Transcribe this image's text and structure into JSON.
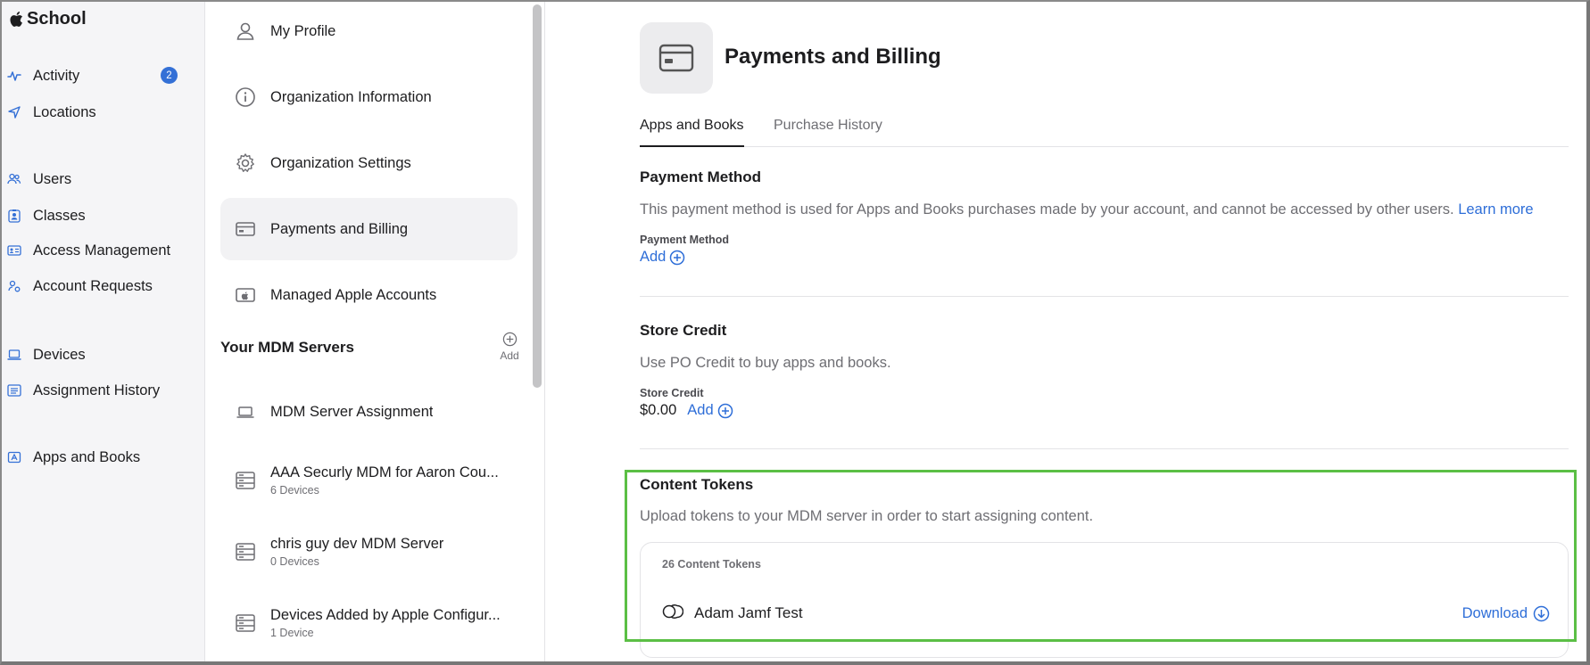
{
  "app": {
    "title": "School"
  },
  "sidebar": {
    "items": [
      {
        "label": "Activity",
        "icon": "activity-icon",
        "badge": "2"
      },
      {
        "label": "Locations",
        "icon": "location-arrow-icon"
      },
      {
        "label": "Users",
        "icon": "users-icon"
      },
      {
        "label": "Classes",
        "icon": "classes-icon"
      },
      {
        "label": "Access Management",
        "icon": "id-card-icon"
      },
      {
        "label": "Account Requests",
        "icon": "account-requests-icon"
      },
      {
        "label": "Devices",
        "icon": "laptop-icon"
      },
      {
        "label": "Assignment History",
        "icon": "list-icon"
      },
      {
        "label": "Apps and Books",
        "icon": "apps-icon"
      }
    ]
  },
  "settings_nav": {
    "items": [
      {
        "label": "My Profile",
        "icon": "person-icon"
      },
      {
        "label": "Organization Information",
        "icon": "info-icon"
      },
      {
        "label": "Organization Settings",
        "icon": "gear-icon"
      },
      {
        "label": "Payments and Billing",
        "icon": "credit-card-icon",
        "active": true
      },
      {
        "label": "Managed Apple Accounts",
        "icon": "apple-account-icon"
      }
    ],
    "mdm_heading": "Your MDM Servers",
    "mdm_add_label": "Add",
    "mdm_items": [
      {
        "label": "MDM Server Assignment",
        "sub": "",
        "icon": "laptop-icon"
      },
      {
        "label": "AAA Securly MDM for Aaron Cou...",
        "sub": "6 Devices",
        "icon": "server-icon"
      },
      {
        "label": "chris guy dev MDM Server",
        "sub": "0 Devices",
        "icon": "server-icon"
      },
      {
        "label": "Devices Added by Apple Configur...",
        "sub": "1 Device",
        "icon": "server-icon"
      }
    ]
  },
  "main": {
    "title": "Payments and Billing",
    "tabs": [
      {
        "label": "Apps and Books",
        "active": true
      },
      {
        "label": "Purchase History",
        "active": false
      }
    ],
    "payment_method": {
      "title": "Payment Method",
      "description": "This payment method is used for Apps and Books purchases made by your account, and cannot be accessed by other users.",
      "learn_more": "Learn more",
      "field_label": "Payment Method",
      "add_label": "Add"
    },
    "store_credit": {
      "title": "Store Credit",
      "description": "Use PO Credit to buy apps and books.",
      "field_label": "Store Credit",
      "amount": "$0.00",
      "add_label": "Add"
    },
    "content_tokens": {
      "title": "Content Tokens",
      "description": "Upload tokens to your MDM server in order to start assigning content.",
      "count_label": "26 Content Tokens",
      "tokens": [
        {
          "name": "Adam Jamf Test",
          "download_label": "Download"
        }
      ]
    }
  },
  "colors": {
    "accent": "#2e6ed8",
    "badge": "#3470d6",
    "highlight": "#5bbf45"
  }
}
